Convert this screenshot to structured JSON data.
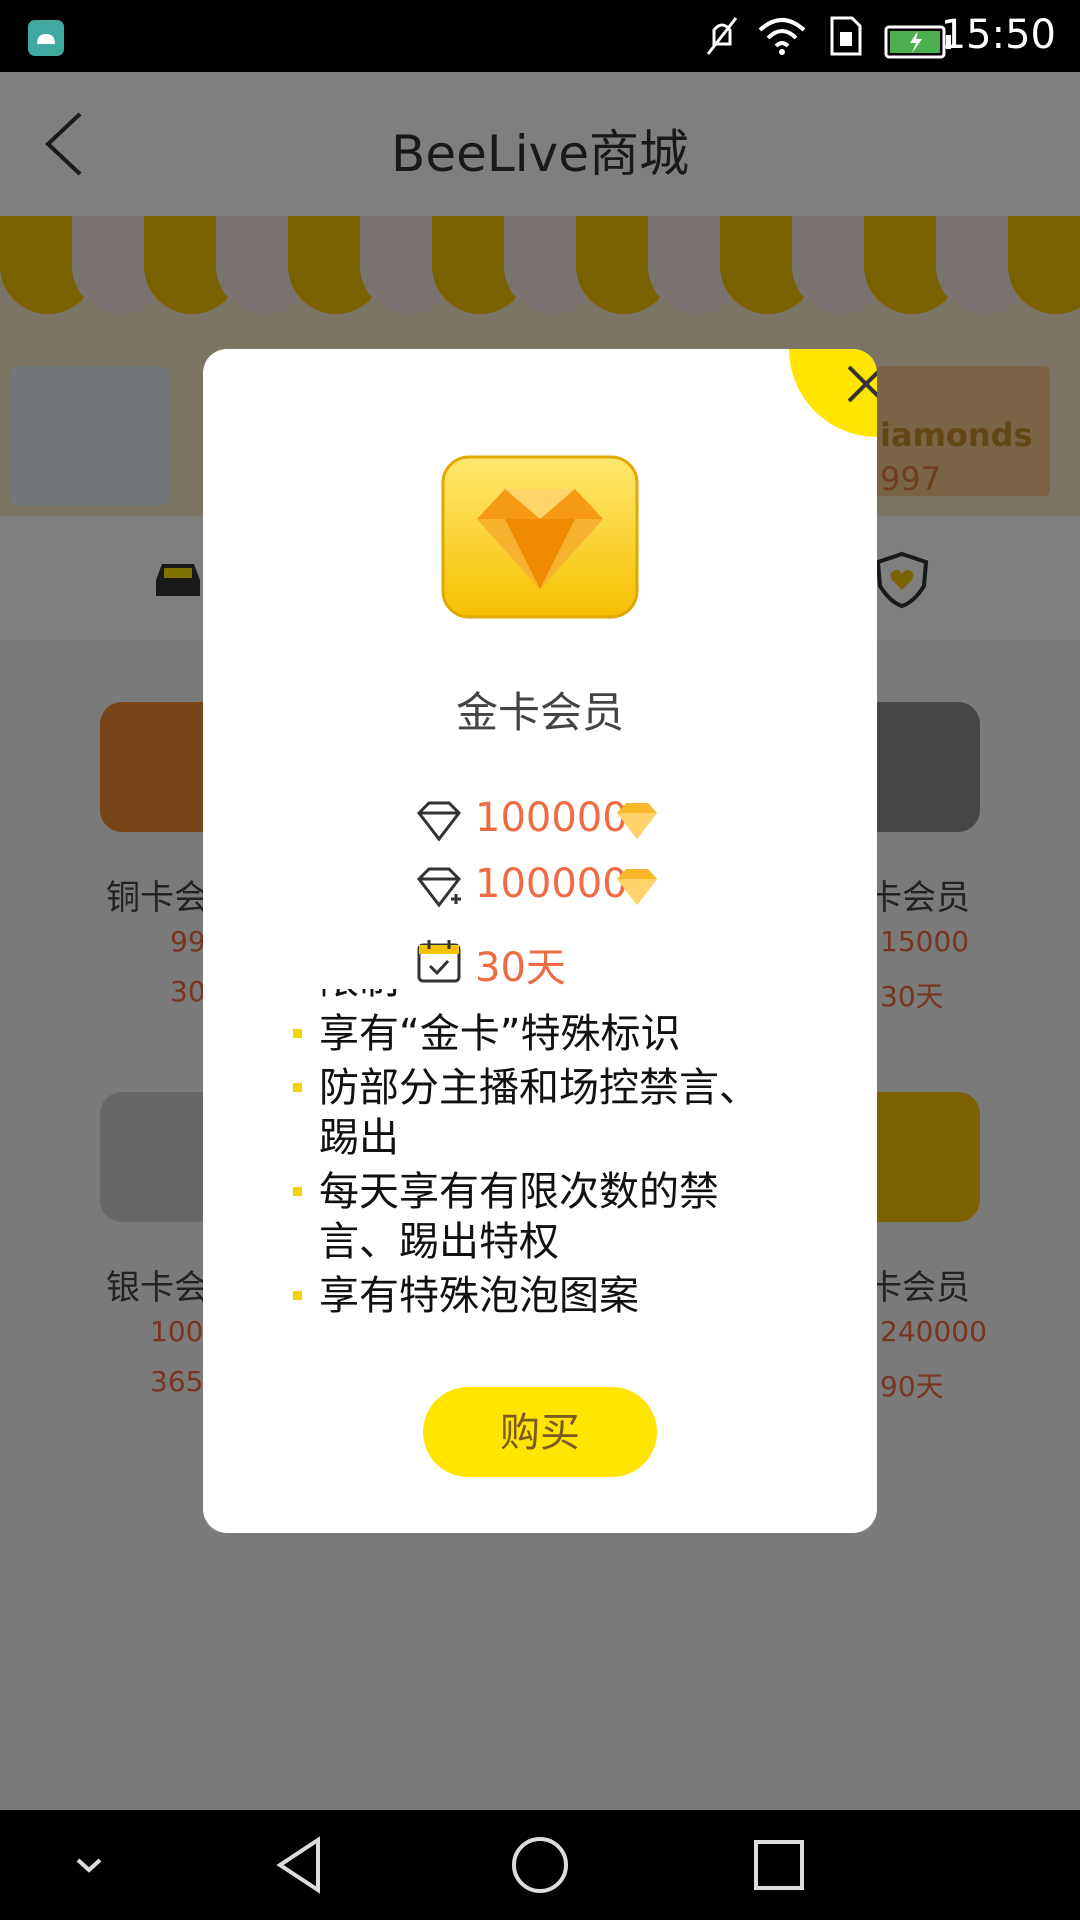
{
  "status_bar": {
    "time": "15:50"
  },
  "app_bar": {
    "title": "BeeLive商城"
  },
  "banner": {
    "label": "iamonds",
    "count": "997"
  },
  "background_cards": [
    {
      "name": "铜卡会",
      "price": "99",
      "days": "30"
    },
    {
      "name": "卡会员",
      "price": "15000",
      "days": "30天"
    },
    {
      "name": "银卡会",
      "price": "100",
      "days": "365"
    },
    {
      "name": "卡会员",
      "price": "240000",
      "days": "90天"
    }
  ],
  "dialog": {
    "title": "金卡会员",
    "price": "100000",
    "renew_price": "100000",
    "duration": "30天",
    "benefit_cut": "限制",
    "benefits": [
      "享有“金卡”特殊标识",
      "防部分主播和场控禁言、踢出",
      "每天享有有限次数的禁言、踢出特权",
      "享有特殊泡泡图案"
    ],
    "buy_label": "购买"
  },
  "colors": {
    "accent": "#ffe500",
    "price": "#ef6c43",
    "scrim": "rgba(0,0,0,0.5)"
  },
  "icons": [
    "android-icon",
    "mute-icon",
    "wifi-icon",
    "sim-icon",
    "battery-icon",
    "back-arrow-icon",
    "car-icon",
    "shield-heart-icon",
    "close-icon",
    "diamond-icon",
    "diamond-renew-icon",
    "calendar-icon",
    "gem-icon",
    "nav-collapse-icon",
    "nav-back-icon",
    "nav-home-icon",
    "nav-recents-icon"
  ]
}
